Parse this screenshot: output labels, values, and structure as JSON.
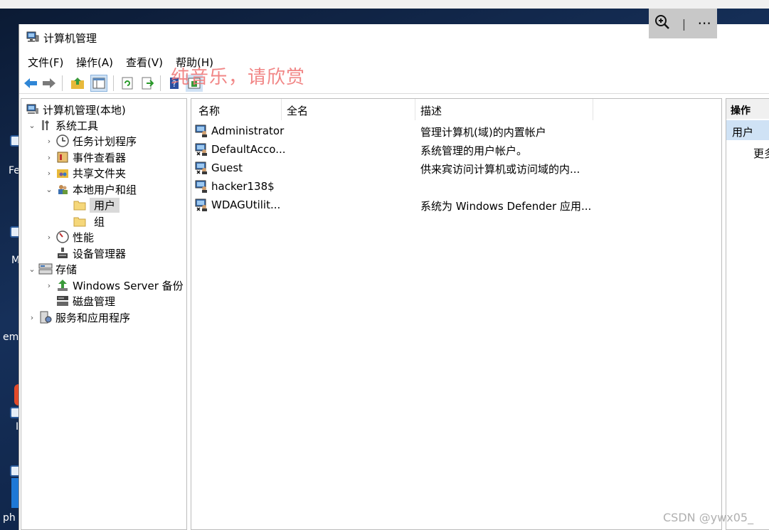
{
  "desktop": {
    "labels": [
      "Fe",
      "M",
      "em",
      "I",
      "ph"
    ]
  },
  "window": {
    "title": "计算机管理"
  },
  "menu": [
    "文件(F)",
    "操作(A)",
    "查看(V)",
    "帮助(H)"
  ],
  "overlay_caption": "纯音乐，请欣赏",
  "zoom_controls": {
    "more_label": "···"
  },
  "tree": {
    "root": "计算机管理(本地)",
    "items": [
      {
        "label": "系统工具"
      },
      {
        "label": "任务计划程序"
      },
      {
        "label": "事件查看器"
      },
      {
        "label": "共享文件夹"
      },
      {
        "label": "本地用户和组"
      },
      {
        "label": "用户"
      },
      {
        "label": "组"
      },
      {
        "label": "性能"
      },
      {
        "label": "设备管理器"
      },
      {
        "label": "存储"
      },
      {
        "label": "Windows Server 备份"
      },
      {
        "label": "磁盘管理"
      },
      {
        "label": "服务和应用程序"
      }
    ]
  },
  "list": {
    "columns": [
      "名称",
      "全名",
      "描述"
    ],
    "rows": [
      {
        "name": "Administrator",
        "fullname": "",
        "desc": "管理计算机(域)的内置帐户"
      },
      {
        "name": "DefaultAcco...",
        "fullname": "",
        "desc": "系统管理的用户帐户。"
      },
      {
        "name": "Guest",
        "fullname": "",
        "desc": "供来宾访问计算机或访问域的内..."
      },
      {
        "name": "hacker138$",
        "fullname": "",
        "desc": ""
      },
      {
        "name": "WDAGUtilit...",
        "fullname": "",
        "desc": "系统为 Windows Defender 应用..."
      }
    ]
  },
  "actions": {
    "header": "操作",
    "section": "用户",
    "more": "更多"
  },
  "watermark": "CSDN @ywx05_"
}
